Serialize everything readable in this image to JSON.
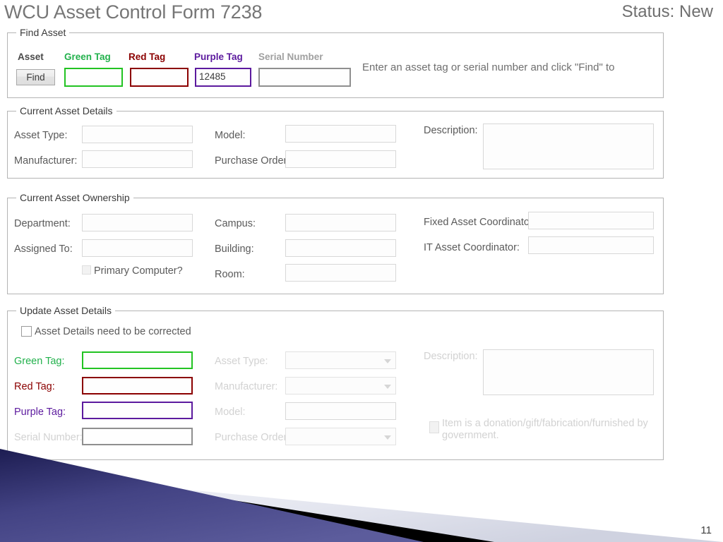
{
  "slide": {
    "title": "WCU Asset Control Form 7238",
    "status": "Status: New",
    "page_number": "11",
    "accent_color": "#2e2e6e",
    "band_color": "#000000",
    "band_light_color": "#e4e6ef"
  },
  "find_asset": {
    "legend": "Find Asset",
    "column_headers": {
      "asset": "Asset",
      "green_tag": "Green Tag",
      "red_tag": "Red Tag",
      "purple_tag": "Purple Tag",
      "serial_number": "Serial Number"
    },
    "find_button": "Find",
    "green_tag_value": "",
    "red_tag_value": "",
    "purple_tag_value": "12485",
    "serial_number_value": "",
    "help_text": "Enter an asset tag or serial number and click \"Find\" to",
    "colors": {
      "green": "#22c322",
      "red": "#8b0000",
      "purple": "#5c1a9e",
      "grey": "#8f8f8f"
    }
  },
  "current_asset_details": {
    "legend": "Current Asset Details",
    "fields": {
      "asset_type": {
        "label": "Asset Type:",
        "value": ""
      },
      "manufacturer": {
        "label": "Manufacturer:",
        "value": ""
      },
      "model": {
        "label": "Model:",
        "value": ""
      },
      "purchase_order": {
        "label": "Purchase Order:",
        "value": ""
      },
      "description": {
        "label": "Description:",
        "value": ""
      }
    }
  },
  "current_asset_ownership": {
    "legend": "Current Asset Ownership",
    "fields": {
      "department": {
        "label": "Department:",
        "value": ""
      },
      "assigned_to": {
        "label": "Assigned To:",
        "value": ""
      },
      "campus": {
        "label": "Campus:",
        "value": ""
      },
      "building": {
        "label": "Building:",
        "value": ""
      },
      "room": {
        "label": "Room:",
        "value": ""
      },
      "fixed_asset_coordinator": {
        "label": "Fixed Asset Coordinator:",
        "value": ""
      },
      "it_asset_coordinator": {
        "label": "IT Asset Coordinator:",
        "value": ""
      }
    },
    "primary_computer_checkbox": {
      "label": "Primary Computer?",
      "checked": false
    }
  },
  "update_asset_details": {
    "legend": "Update Asset Details",
    "correction_checkbox": {
      "label": "Asset Details need to be corrected",
      "checked": false
    },
    "fields": {
      "green_tag": {
        "label": "Green Tag:",
        "value": ""
      },
      "red_tag": {
        "label": "Red Tag:",
        "value": ""
      },
      "purple_tag": {
        "label": "Purple Tag:",
        "value": ""
      },
      "serial_number": {
        "label": "Serial Number:",
        "value": ""
      },
      "asset_type": {
        "label": "Asset Type:",
        "value": ""
      },
      "manufacturer": {
        "label": "Manufacturer:",
        "value": ""
      },
      "model": {
        "label": "Model:",
        "value": ""
      },
      "purchase_order": {
        "label": "Purchase Order:",
        "value": ""
      },
      "description": {
        "label": "Description:",
        "value": ""
      }
    },
    "donation_checkbox": {
      "label": "Item is a donation/gift/fabrication/furnished by government.",
      "checked": false
    }
  }
}
